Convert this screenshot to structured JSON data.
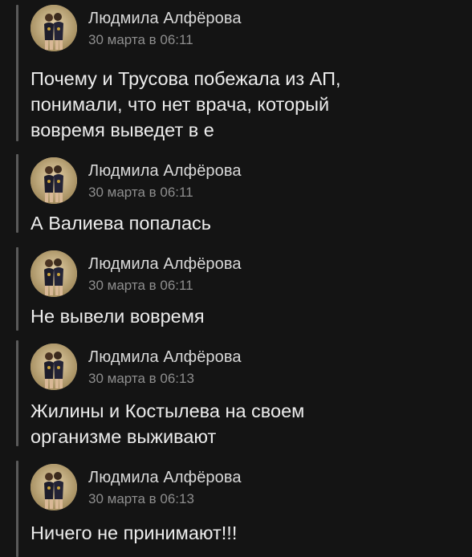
{
  "messages": [
    {
      "author": "Людмила Алфёрова",
      "time": "30 марта в 06:11",
      "text_lines": [
        "Почему и Трусова побежала из АП,",
        "понимали, что нет врача, который",
        "вовремя выведет в е"
      ],
      "avatar_icon": "user-avatar-icon"
    },
    {
      "author": "Людмила Алфёрова",
      "time": "30 марта в 06:11",
      "text_lines": [
        "А Валиева попалась"
      ],
      "avatar_icon": "user-avatar-icon"
    },
    {
      "author": "Людмила Алфёрова",
      "time": "30 марта в 06:11",
      "text_lines": [
        "Не вывели вовремя"
      ],
      "avatar_icon": "user-avatar-icon"
    },
    {
      "author": "Людмила Алфёрова",
      "time": "30 марта в 06:13",
      "text_lines": [
        "Жилины и Костылева на своем",
        "организме выживают"
      ],
      "avatar_icon": "user-avatar-icon"
    },
    {
      "author": "Людмила Алфёрова",
      "time": "30 марта в 06:13",
      "text_lines": [
        "Ничего не принимают!!!"
      ],
      "avatar_icon": "user-avatar-icon"
    }
  ],
  "colors": {
    "background": "#141414",
    "text": "#ececec",
    "author": "#d9d9d9",
    "time": "#8e8e8e",
    "rail": "#5a5a5a"
  }
}
